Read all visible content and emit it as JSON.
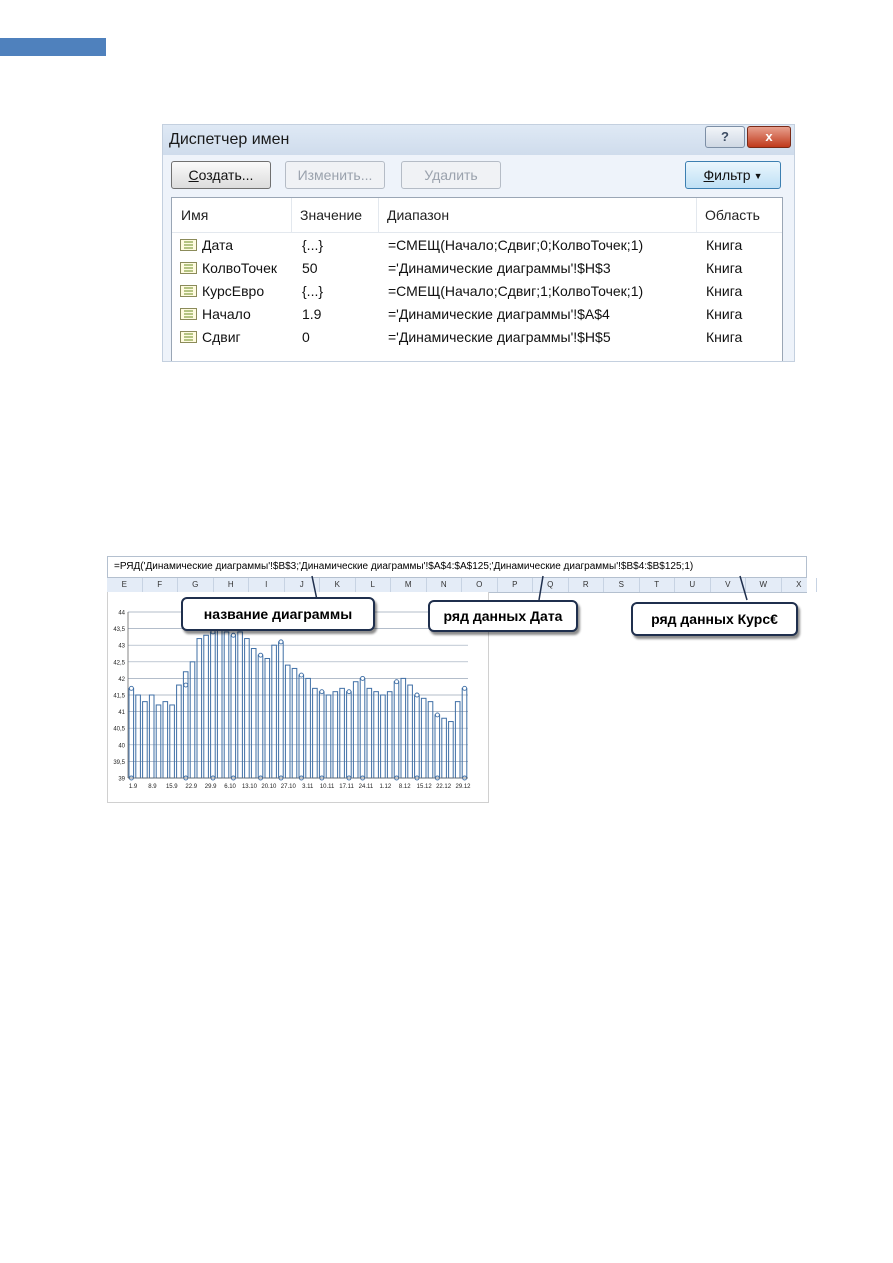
{
  "dialog": {
    "title": "Диспетчер имен",
    "help_label": "?",
    "close_label": "x",
    "buttons": {
      "create_u": "С",
      "create_rest": "оздать...",
      "edit": "Изменить...",
      "delete": "Удалить",
      "filter_u": "Ф",
      "filter_rest": "ильтр",
      "filter_arrow": "▼"
    },
    "columns": [
      "Имя",
      "Значение",
      "Диапазон",
      "Область"
    ],
    "rows": [
      {
        "name": "Дата",
        "value": "{...}",
        "range": "=СМЕЩ(Начало;Сдвиг;0;КолвоТочек;1)",
        "scope": "Книга"
      },
      {
        "name": "КолвоТочек",
        "value": "50",
        "range": "='Динамические диаграммы'!$H$3",
        "scope": "Книга"
      },
      {
        "name": "КурсЕвро",
        "value": "{...}",
        "range": "=СМЕЩ(Начало;Сдвиг;1;КолвоТочек;1)",
        "scope": "Книга"
      },
      {
        "name": "Начало",
        "value": "1.9",
        "range": "='Динамические диаграммы'!$A$4",
        "scope": "Книга"
      },
      {
        "name": "Сдвиг",
        "value": "0",
        "range": "='Динамические диаграммы'!$H$5",
        "scope": "Книга"
      }
    ]
  },
  "excel": {
    "formula": "=РЯД('Динамические диаграммы'!$B$3;'Динамические диаграммы'!$A$4:$A$125;'Динамические диаграммы'!$B$4:$B$125;1)",
    "columns": [
      "E",
      "F",
      "G",
      "H",
      "I",
      "J",
      "K",
      "L",
      "M",
      "N",
      "O",
      "P",
      "Q",
      "R",
      "S",
      "T",
      "U",
      "V",
      "W",
      "X"
    ],
    "callouts": {
      "chart_name": "название диаграммы",
      "date_series": "ряд данных Дата",
      "rate_series": "ряд данных Курс€"
    }
  },
  "colors": {
    "accent": "#4f81bd",
    "bar": "#3f6fa6",
    "grid": "#9aa7b8",
    "callout_border": "#1f2f4d"
  },
  "chart_data": {
    "type": "bar",
    "title": "",
    "xlabel": "",
    "ylabel": "",
    "ylim": [
      39,
      44
    ],
    "yticks": [
      "44",
      "43,5",
      "43",
      "42,5",
      "42",
      "41,5",
      "41",
      "40,5",
      "40",
      "39,5",
      "39"
    ],
    "xtick_labels": [
      "1.9",
      "8.9",
      "15.9",
      "22.9",
      "29.9",
      "6.10",
      "13.10",
      "20.10",
      "27.10",
      "3.11",
      "10.11",
      "17.11",
      "24.11",
      "1.12",
      "8.12",
      "15.12",
      "22.12",
      "29.12"
    ],
    "values": [
      41.7,
      41.5,
      41.3,
      41.5,
      41.2,
      41.3,
      41.2,
      41.8,
      42.2,
      42.5,
      43.2,
      43.3,
      43.4,
      43.5,
      43.4,
      43.3,
      43.4,
      43.2,
      42.9,
      42.7,
      42.6,
      43.0,
      43.1,
      42.4,
      42.3,
      42.1,
      42.0,
      41.7,
      41.6,
      41.5,
      41.6,
      41.7,
      41.6,
      41.9,
      42.0,
      41.7,
      41.6,
      41.5,
      41.6,
      41.9,
      42.0,
      41.8,
      41.5,
      41.4,
      41.3,
      40.9,
      40.8,
      40.7,
      41.3,
      41.7
    ],
    "markers": [
      {
        "i": 0,
        "v": 41.7
      },
      {
        "i": 8,
        "v": 41.8
      },
      {
        "i": 12,
        "v": 43.4
      },
      {
        "i": 15,
        "v": 43.3
      },
      {
        "i": 19,
        "v": 42.7
      },
      {
        "i": 22,
        "v": 43.1
      },
      {
        "i": 25,
        "v": 42.1
      },
      {
        "i": 28,
        "v": 41.6
      },
      {
        "i": 32,
        "v": 41.6
      },
      {
        "i": 34,
        "v": 42.0
      },
      {
        "i": 39,
        "v": 41.9
      },
      {
        "i": 42,
        "v": 41.5
      },
      {
        "i": 45,
        "v": 40.9
      },
      {
        "i": 49,
        "v": 41.7
      }
    ]
  }
}
